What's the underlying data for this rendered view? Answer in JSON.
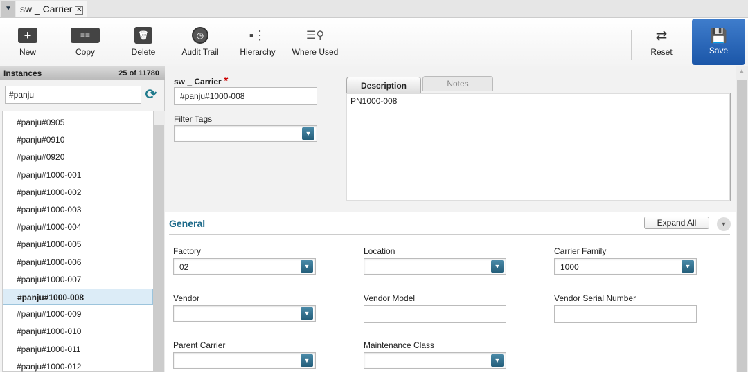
{
  "tab": {
    "title": "sw _ Carrier",
    "close": "✕"
  },
  "toolbar": {
    "new": "New",
    "copy": "Copy",
    "delete": "Delete",
    "audit": "Audit Trail",
    "hierarchy": "Hierarchy",
    "where_used": "Where Used",
    "reset": "Reset",
    "save": "Save"
  },
  "instances": {
    "title": "Instances",
    "count": "25 of 11780",
    "search_value": "#panju",
    "items": [
      "#panju#0905",
      "#panju#0910",
      "#panju#0920",
      "#panju#1000-001",
      "#panju#1000-002",
      "#panju#1000-003",
      "#panju#1000-004",
      "#panju#1000-005",
      "#panju#1000-006",
      "#panju#1000-007",
      "#panju#1000-008",
      "#panju#1000-009",
      "#panju#1000-010",
      "#panju#1000-011",
      "#panju#1000-012"
    ],
    "selected": "#panju#1000-008"
  },
  "form": {
    "name_label": "sw _ Carrier",
    "required": "*",
    "name_value": "#panju#1000-008",
    "filter_tags_label": "Filter Tags",
    "desc_tab": "Description",
    "notes_tab": "Notes",
    "description": "PN1000-008"
  },
  "general": {
    "title": "General",
    "expand_all": "Expand All",
    "fields": {
      "factory": {
        "label": "Factory",
        "value": "02"
      },
      "location": {
        "label": "Location",
        "value": ""
      },
      "carrier_family": {
        "label": "Carrier Family",
        "value": "1000"
      },
      "vendor": {
        "label": "Vendor",
        "value": ""
      },
      "vendor_model": {
        "label": "Vendor Model",
        "value": ""
      },
      "vendor_serial": {
        "label": "Vendor Serial Number",
        "value": ""
      },
      "parent_carrier": {
        "label": "Parent Carrier",
        "value": ""
      },
      "maintenance_class": {
        "label": "Maintenance Class",
        "value": ""
      }
    }
  },
  "colors": {
    "accent": "#1d6a8a",
    "save": "#1b56a8"
  }
}
